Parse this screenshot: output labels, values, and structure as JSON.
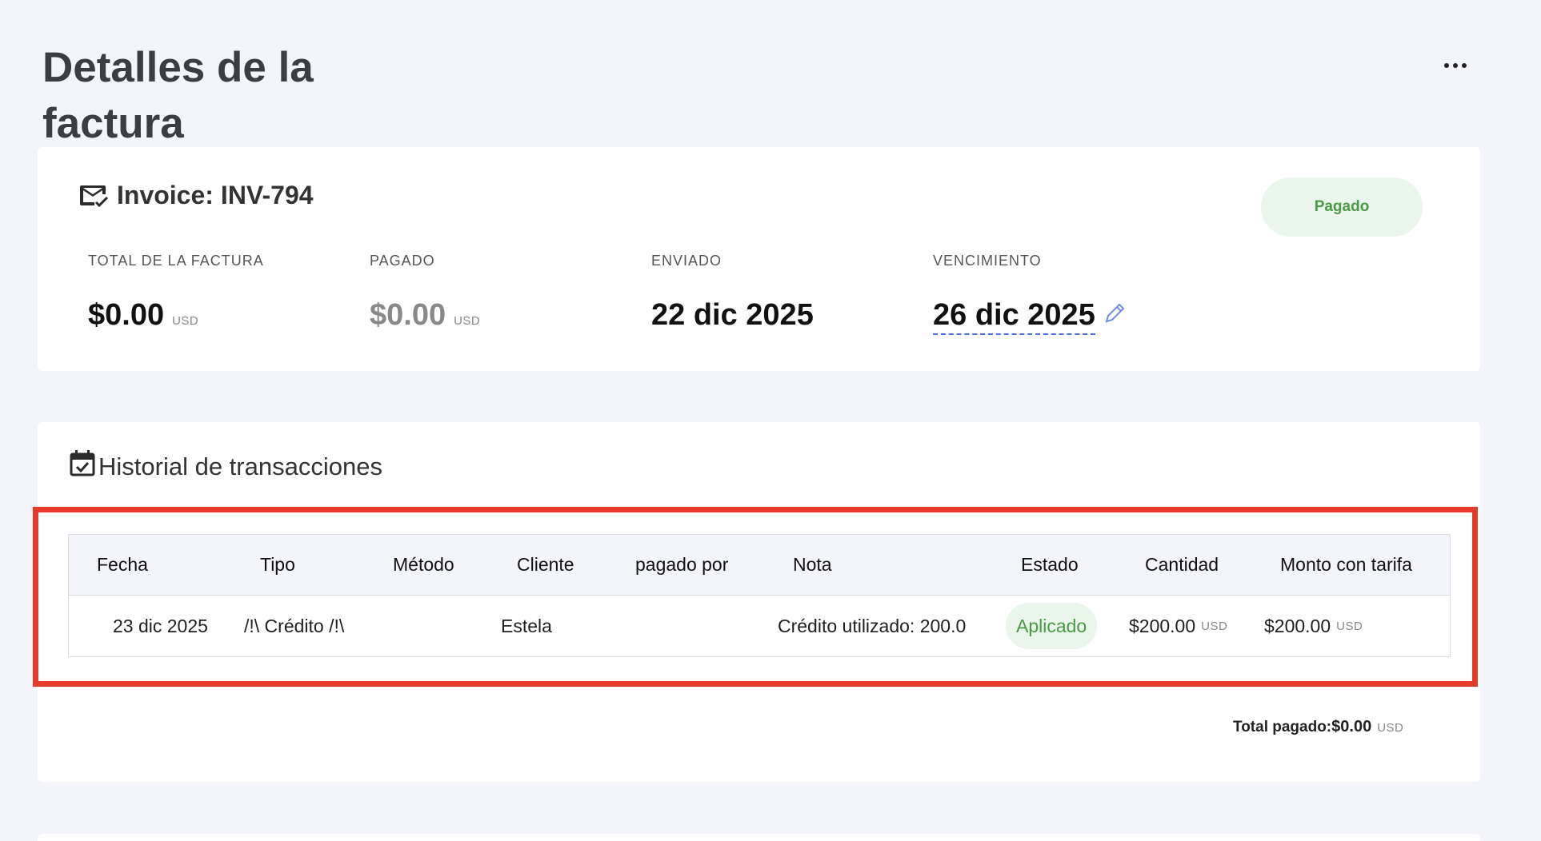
{
  "page": {
    "title": "Detalles de la factura",
    "menu_icon": "more-horizontal-icon"
  },
  "invoice": {
    "icon": "mail-check-icon",
    "title_prefix": "Invoice:",
    "number": "INV-794",
    "status": "Pagado",
    "status_color": "#4a9a45",
    "stats": {
      "total": {
        "label": "TOTAL DE LA FACTURA",
        "value": "$0.00",
        "currency": "USD"
      },
      "paid": {
        "label": "PAGADO",
        "value": "$0.00",
        "currency": "USD"
      },
      "sent": {
        "label": "ENVIADO",
        "value": "22 dic 2025"
      },
      "due": {
        "label": "VENCIMIENTO",
        "value": "26 dic 2025",
        "edit_icon": "pencil-icon"
      }
    }
  },
  "history": {
    "icon": "calendar-check-icon",
    "title": "Historial de transacciones",
    "columns": [
      "Fecha",
      "Tipo",
      "Método",
      "Cliente",
      "pagado por",
      "Nota",
      "Estado",
      "Cantidad",
      "Monto con tarifa"
    ],
    "rows": [
      {
        "fecha": "23 dic 2025",
        "tipo": "/!\\ Crédito /!\\",
        "metodo": "",
        "cliente": "Estela",
        "pagado_por": "",
        "nota": "Crédito utilizado: 200.0",
        "estado": "Aplicado",
        "cantidad": "$200.00",
        "cantidad_currency": "USD",
        "monto_tarifa": "$200.00",
        "monto_tarifa_currency": "USD"
      }
    ],
    "total_label": "Total pagado:",
    "total_value": "$0.00",
    "total_currency": "USD"
  },
  "colors": {
    "background": "#f4f5fa",
    "success_bg": "#eaf6ec",
    "success_text": "#4a9a45",
    "highlight": "#e53b2a",
    "link_blue": "#4a6de0"
  }
}
